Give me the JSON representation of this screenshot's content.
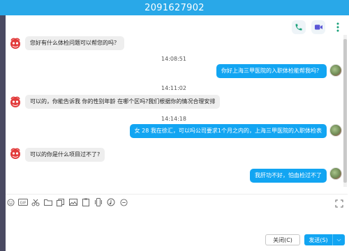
{
  "window": {
    "title": "2091627902"
  },
  "toolbar_top": [
    {
      "icon": "phone-icon"
    },
    {
      "icon": "video-icon"
    },
    {
      "icon": "more-icon"
    }
  ],
  "messages": [
    {
      "type": "in",
      "text": "您好有什么体检问题可以帮您的吗？"
    },
    {
      "type": "time",
      "text": "14:08:51"
    },
    {
      "type": "out",
      "text": "你好上海三甲医院的入职体检能帮我吗？"
    },
    {
      "type": "time",
      "text": "14:11:02"
    },
    {
      "type": "in",
      "text": "可以的，你能告诉我 你的性别年龄 在哪个区吗?我们根据你的情况合理安排"
    },
    {
      "type": "time",
      "text": "14:14:18"
    },
    {
      "type": "out",
      "text": "女 28 我在徐汇，可以吗公司要求1个月之内的，上海三甲医院的入职体检表"
    },
    {
      "type": "in",
      "text": "可以的你是什么项目过不了?"
    },
    {
      "type": "out",
      "text": "我肝功不好，怕血检过不了"
    }
  ],
  "input_toolbar": [
    "emoji-icon",
    "gif-icon",
    "scissors-icon",
    "folder-icon",
    "files-icon",
    "image-icon",
    "clipboard-icon",
    "phone-shake-icon",
    "music-icon",
    "minus-circle-icon"
  ],
  "buttons": {
    "close_label": "关闭(C)",
    "send_label": "发送(S)",
    "send_arrow": "⌵"
  },
  "colors": {
    "titlebar": "#29a8e8",
    "outgoing_bubble": "#12a5f2",
    "incoming_bubble": "#eeeeee"
  }
}
